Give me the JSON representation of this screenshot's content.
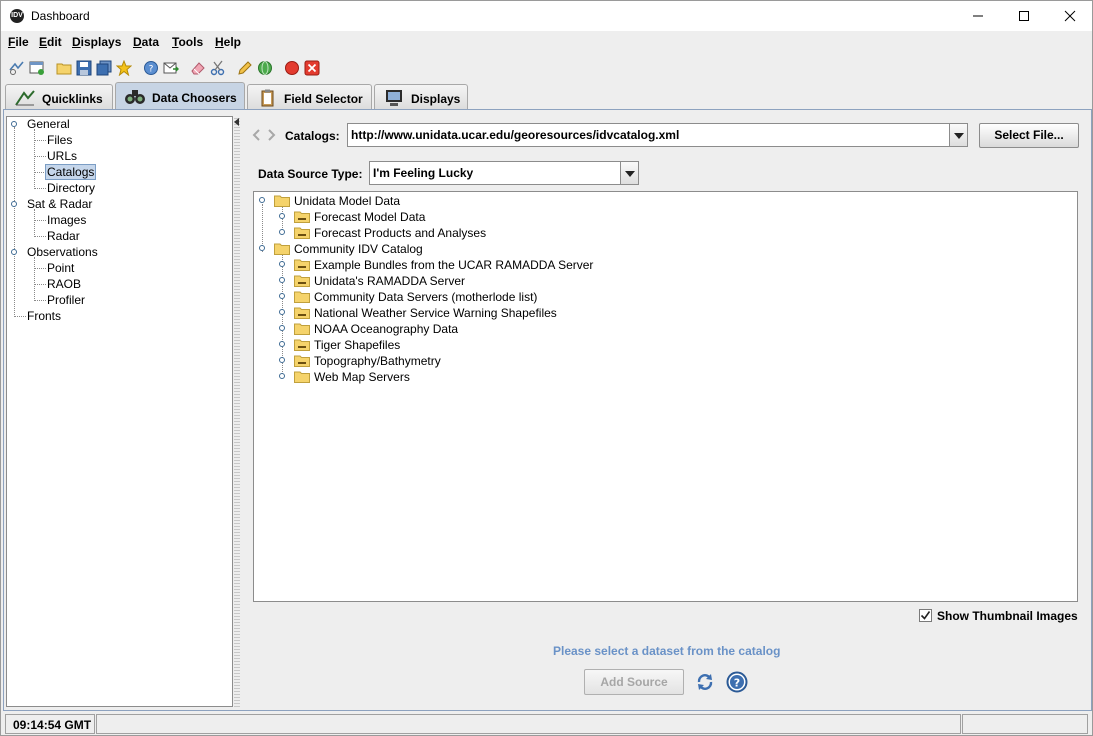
{
  "window": {
    "title": "Dashboard"
  },
  "menu": [
    {
      "label": "File",
      "u": "F",
      "rest": "ile"
    },
    {
      "label": "Edit",
      "u": "E",
      "rest": "dit"
    },
    {
      "label": "Displays",
      "u": "D",
      "rest": "isplays"
    },
    {
      "label": "Data",
      "u": "D",
      "rest": "ata"
    },
    {
      "label": "Tools",
      "u": "T",
      "rest": "ools"
    },
    {
      "label": "Help",
      "u": "H",
      "rest": "elp"
    }
  ],
  "tabs": [
    {
      "label": "Quicklinks",
      "icon": "quicklinks-icon"
    },
    {
      "label": "Data Choosers",
      "icon": "binoculars-icon",
      "active": true
    },
    {
      "label": "Field Selector",
      "icon": "clipboard-icon"
    },
    {
      "label": "Displays",
      "icon": "monitor-icon"
    }
  ],
  "left_tree": {
    "general": {
      "label": "General",
      "children": [
        "Files",
        "URLs",
        "Catalogs",
        "Directory"
      ]
    },
    "sat_radar": {
      "label": "Sat & Radar",
      "children": [
        "Images",
        "Radar"
      ]
    },
    "observations": {
      "label": "Observations",
      "children": [
        "Point",
        "RAOB",
        "Profiler"
      ]
    },
    "fronts": "Fronts",
    "selected": "Catalogs"
  },
  "catalogs": {
    "label": "Catalogs:",
    "url": "http://www.unidata.ucar.edu/georesources/idvcatalog.xml",
    "select_file_label": "Select File..."
  },
  "data_source_type": {
    "label": "Data Source Type:",
    "value": "I'm Feeling Lucky"
  },
  "catalog_tree": {
    "unidata": {
      "label": "Unidata Model Data",
      "children": [
        "Forecast Model Data",
        "Forecast Products and Analyses"
      ]
    },
    "community": {
      "label": "Community IDV Catalog",
      "children": [
        "Example Bundles from the UCAR RAMADDA Server",
        "Unidata's RAMADDA Server",
        "Community Data Servers (motherlode list)",
        "National Weather Service Warning Shapefiles",
        "NOAA Oceanography Data",
        "Tiger Shapefiles",
        "Topography/Bathymetry",
        "Web Map Servers"
      ]
    }
  },
  "show_thumbnails": {
    "label": "Show Thumbnail Images",
    "checked": true
  },
  "status_message": "Please select a dataset from the catalog",
  "add_source_label": "Add Source",
  "status_bar": {
    "time": "09:14:54 GMT"
  },
  "colors": {
    "accent": "#c7d4e4",
    "status_text": "#6a92c7",
    "folder": "#f5d36b"
  }
}
